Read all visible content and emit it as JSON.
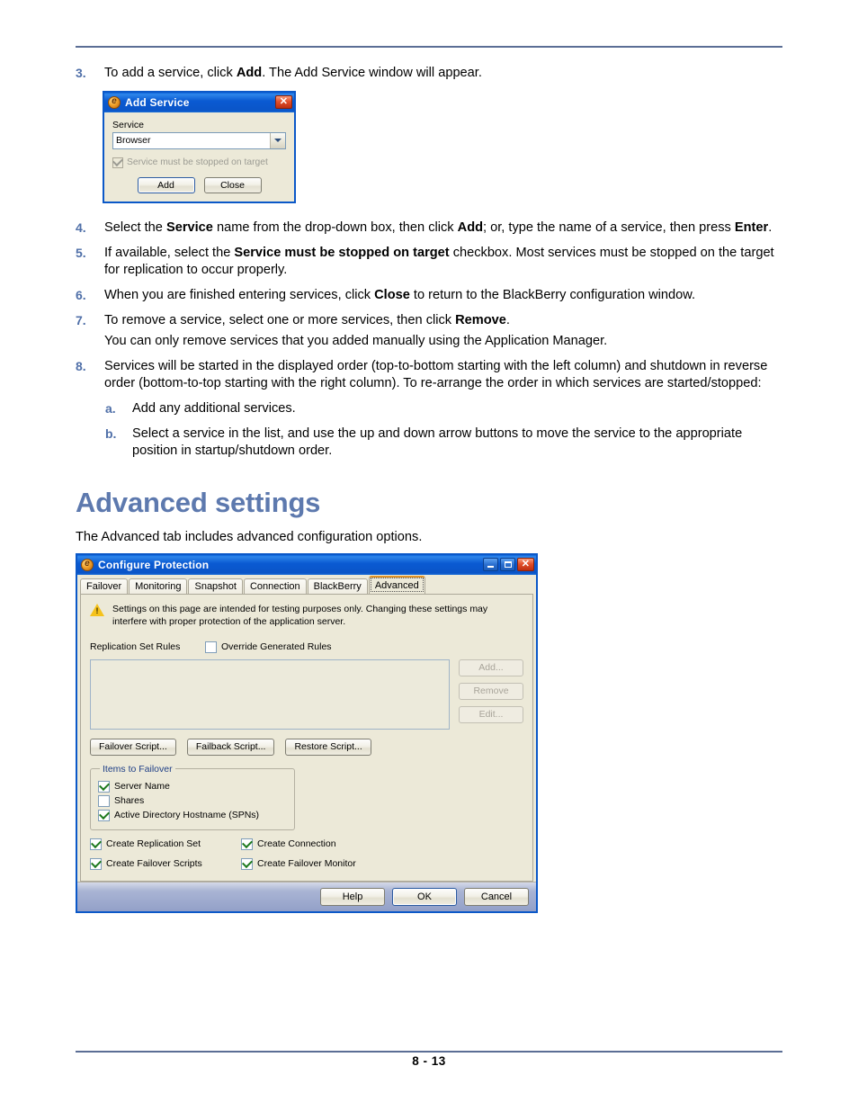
{
  "page": {
    "number": "8 - 13"
  },
  "steps": [
    {
      "num": "3.",
      "parts": [
        {
          "t": "To add a service, click ",
          "b": false
        },
        {
          "t": "Add",
          "b": true
        },
        {
          "t": ". The Add Service window will appear.",
          "b": false
        }
      ]
    },
    {
      "num": "4.",
      "parts": [
        {
          "t": "Select the ",
          "b": false
        },
        {
          "t": "Service",
          "b": true
        },
        {
          "t": " name from the drop-down box, then click ",
          "b": false
        },
        {
          "t": "Add",
          "b": true
        },
        {
          "t": "; or, type the name of a service, then press ",
          "b": false
        },
        {
          "t": "Enter",
          "b": true
        },
        {
          "t": ".",
          "b": false
        }
      ]
    },
    {
      "num": "5.",
      "parts": [
        {
          "t": "If available, select the ",
          "b": false
        },
        {
          "t": "Service must be stopped on target",
          "b": true
        },
        {
          "t": " checkbox. Most services must be stopped on the target for replication to occur properly.",
          "b": false
        }
      ]
    },
    {
      "num": "6.",
      "parts": [
        {
          "t": "When you are finished entering services, click ",
          "b": false
        },
        {
          "t": "Close",
          "b": true
        },
        {
          "t": " to return to the BlackBerry configuration window.",
          "b": false
        }
      ]
    },
    {
      "num": "7.",
      "parts": [
        {
          "t": "To remove a service, select one or more services, then click ",
          "b": false
        },
        {
          "t": "Remove",
          "b": true
        },
        {
          "t": ".",
          "b": false
        }
      ]
    }
  ],
  "note_after_7": "You can only remove services that you added manually using the Application Manager.",
  "step8": {
    "num": "8.",
    "text": "Services will be started in the displayed order (top-to-bottom starting with the left column) and shutdown in reverse order (bottom-to-top starting with the right column). To re-arrange the order in which services are started/stopped:"
  },
  "substeps": [
    {
      "num": "a.",
      "text": "Add any additional services."
    },
    {
      "num": "b.",
      "text": "Select a service in the list, and use the up and down arrow buttons to move the service to the appropriate position in startup/shutdown order."
    }
  ],
  "section": {
    "title": "Advanced settings",
    "intro": "The Advanced tab includes advanced configuration options.",
    "title_color": "#5d79ae"
  },
  "add_service_dialog": {
    "title": "Add Service",
    "icon": "app-icon",
    "close_glyph": "✕",
    "service_label": "Service",
    "service_value": "Browser",
    "service_options": [
      "Browser"
    ],
    "checkbox_label": "Service must be stopped on target",
    "checkbox_checked": true,
    "checkbox_enabled": false,
    "add_label": "Add",
    "close_label": "Close"
  },
  "configure_protection": {
    "title": "Configure Protection",
    "minimize_tooltip": "Minimize",
    "maximize_tooltip": "Maximize",
    "close_tooltip": "Close",
    "tabs": [
      {
        "label": "Failover",
        "active": false
      },
      {
        "label": "Monitoring",
        "active": false
      },
      {
        "label": "Snapshot",
        "active": false
      },
      {
        "label": "Connection",
        "active": false
      },
      {
        "label": "BlackBerry",
        "active": false
      },
      {
        "label": "Advanced",
        "active": true
      }
    ],
    "warning": "Settings on this page are intended for testing purposes only.  Changing these settings may interfere with proper protection of the application server.",
    "replication_set_rules_label": "Replication Set Rules",
    "override_generated_rules": {
      "label": "Override Generated Rules",
      "checked": false
    },
    "rules_list_items": [],
    "list_buttons": [
      {
        "label": "Add...",
        "enabled": false
      },
      {
        "label": "Remove",
        "enabled": false
      },
      {
        "label": "Edit...",
        "enabled": false
      }
    ],
    "script_buttons": [
      {
        "label": "Failover Script...",
        "enabled": true
      },
      {
        "label": "Failback Script...",
        "enabled": true
      },
      {
        "label": "Restore Script...",
        "enabled": true
      }
    ],
    "items_to_failover": {
      "legend": "Items to Failover",
      "items": [
        {
          "label": "Server Name",
          "checked": true
        },
        {
          "label": "Shares",
          "checked": false
        },
        {
          "label": "Active Directory Hostname (SPNs)",
          "checked": true
        }
      ]
    },
    "create_options": [
      {
        "label": "Create Replication Set",
        "checked": true
      },
      {
        "label": "Create Connection",
        "checked": true
      },
      {
        "label": "Create Failover Scripts",
        "checked": true
      },
      {
        "label": "Create Failover Monitor",
        "checked": true
      }
    ],
    "footer_buttons": [
      {
        "label": "Help",
        "default": false
      },
      {
        "label": "OK",
        "default": true
      },
      {
        "label": "Cancel",
        "default": false
      }
    ]
  }
}
